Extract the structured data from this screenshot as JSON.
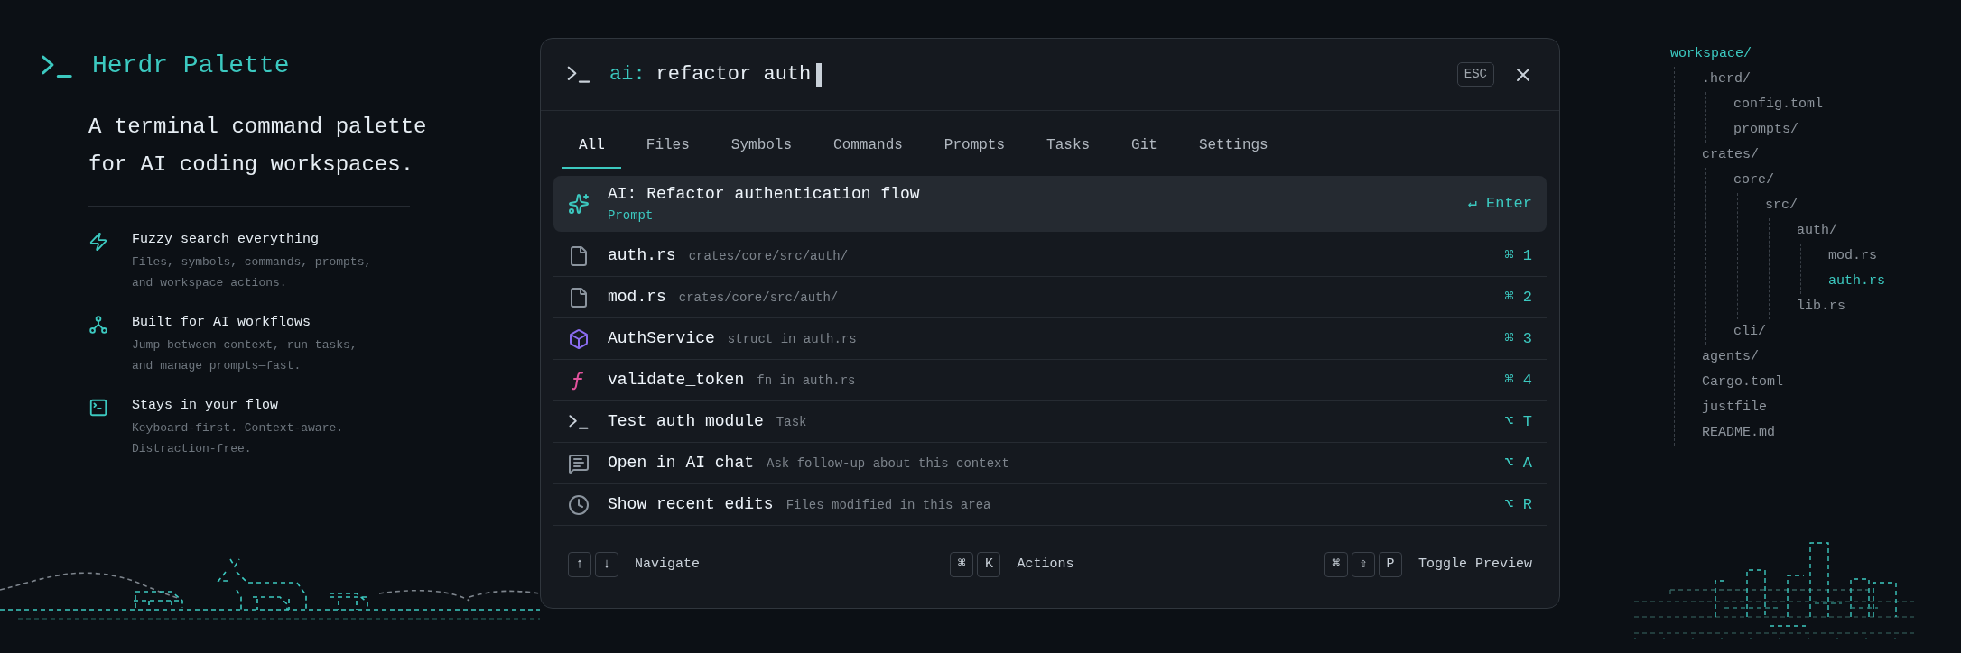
{
  "brand": {
    "title": "Herdr Palette",
    "tagline": "A terminal command palette for AI coding workspaces."
  },
  "features": [
    {
      "kind": "bolt",
      "title": "Fuzzy search everything",
      "description": "Files, symbols, commands, prompts, and workspace actions."
    },
    {
      "kind": "workflow",
      "title": "Built for AI workflows",
      "description": "Jump between context, run tasks, and manage prompts—fast."
    },
    {
      "kind": "terminal",
      "title": "Stays in your flow",
      "description": "Keyboard-first. Context-aware. Distraction-free."
    }
  ],
  "palette": {
    "query": {
      "prefix": "ai:",
      "text": "refactor auth"
    },
    "escape_key": "ESC",
    "tabs": [
      {
        "label": "All",
        "selected": true
      },
      {
        "label": "Files",
        "selected": false
      },
      {
        "label": "Symbols",
        "selected": false
      },
      {
        "label": "Commands",
        "selected": false
      },
      {
        "label": "Prompts",
        "selected": false
      },
      {
        "label": "Tasks",
        "selected": false
      },
      {
        "label": "Git",
        "selected": false
      },
      {
        "label": "Settings",
        "selected": false
      }
    ],
    "results": [
      {
        "kind": "prompt",
        "title": "AI: Refactor authentication flow",
        "subtitle": "Prompt",
        "shortcut": "↵ Enter",
        "selected": true
      },
      {
        "kind": "file",
        "title": "auth.rs",
        "subtitle": "crates/core/src/auth/",
        "shortcut": "⌘ 1",
        "selected": false
      },
      {
        "kind": "file",
        "title": "mod.rs",
        "subtitle": "crates/core/src/auth/",
        "shortcut": "⌘ 2",
        "selected": false
      },
      {
        "kind": "struct",
        "title": "AuthService",
        "subtitle": "struct in auth.rs",
        "shortcut": "⌘ 3",
        "selected": false
      },
      {
        "kind": "function",
        "title": "validate_token",
        "subtitle": "fn in auth.rs",
        "shortcut": "⌘ 4",
        "selected": false
      },
      {
        "kind": "task",
        "title": "Test auth module",
        "subtitle": "Task",
        "shortcut": "⌥ T",
        "selected": false
      },
      {
        "kind": "chat",
        "title": "Open in AI chat",
        "subtitle": "Ask follow-up about this context",
        "shortcut": "⌥ A",
        "selected": false
      },
      {
        "kind": "history",
        "title": "Show recent edits",
        "subtitle": "Files modified in this area",
        "shortcut": "⌥ R",
        "selected": false
      }
    ],
    "footer": [
      {
        "keys": [
          "↑",
          "↓"
        ],
        "label": "Navigate"
      },
      {
        "keys": [
          "⌘",
          "K"
        ],
        "label": "Actions"
      },
      {
        "keys": [
          "⌘",
          "⇧",
          "P"
        ],
        "label": "Toggle Preview"
      }
    ]
  },
  "tree": {
    "name": "workspace/",
    "children": [
      {
        "name": ".herd/",
        "selected": false,
        "children": [
          {
            "name": "config.toml",
            "selected": false
          },
          {
            "name": "prompts/",
            "selected": false
          }
        ]
      },
      {
        "name": "crates/",
        "selected": false,
        "children": [
          {
            "name": "core/",
            "selected": false,
            "children": [
              {
                "name": "src/",
                "selected": false,
                "children": [
                  {
                    "name": "auth/",
                    "selected": false,
                    "children": [
                      {
                        "name": "mod.rs",
                        "selected": false
                      },
                      {
                        "name": "auth.rs",
                        "selected": true
                      }
                    ]
                  },
                  {
                    "name": "lib.rs",
                    "selected": false
                  }
                ]
              }
            ]
          },
          {
            "name": "cli/",
            "selected": false
          }
        ]
      },
      {
        "name": "agents/",
        "selected": false
      },
      {
        "name": "Cargo.toml",
        "selected": false
      },
      {
        "name": "justfile",
        "selected": false
      },
      {
        "name": "README.md",
        "selected": false
      }
    ]
  }
}
